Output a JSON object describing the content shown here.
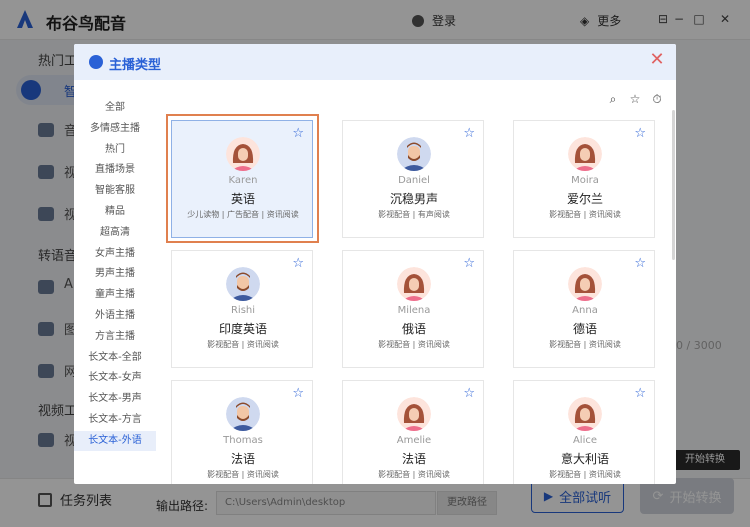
{
  "app": {
    "title": "布谷鸟配音",
    "login_label": "登录",
    "more_label": "更多",
    "minimize_glyph": "⊟",
    "restore_glyph": "−",
    "maximize_glyph": "□",
    "close_glyph": "✕"
  },
  "sidebar": {
    "items": [
      {
        "label": "热门工"
      },
      {
        "label": "智"
      },
      {
        "label": "音"
      },
      {
        "label": "视"
      },
      {
        "label": "视"
      },
      {
        "label": "转语音"
      },
      {
        "label": "A"
      },
      {
        "label": "图"
      },
      {
        "label": "网"
      },
      {
        "label": "视频工"
      },
      {
        "label": "视"
      }
    ]
  },
  "background": {
    "counter": "0 / 3000",
    "task_list_label": "任务列表",
    "output_path_label": "输出路径:",
    "output_path_value": "C:\\Users\\Admin\\desktop",
    "change_path_label": "更改路径",
    "trial_all_label": "全部试听",
    "start_convert_label": "开始转换",
    "tooltip": "开始转换"
  },
  "modal": {
    "title": "主播类型",
    "close_glyph": "✕",
    "categories": [
      {
        "label": "全部"
      },
      {
        "label": "多情感主播"
      },
      {
        "label": "热门"
      },
      {
        "label": "直播场景"
      },
      {
        "label": "智能客服"
      },
      {
        "label": "精品"
      },
      {
        "label": "超高清"
      },
      {
        "label": "女声主播"
      },
      {
        "label": "男声主播"
      },
      {
        "label": "童声主播"
      },
      {
        "label": "外语主播"
      },
      {
        "label": "方言主播"
      },
      {
        "label": "长文本-全部"
      },
      {
        "label": "长文本-女声"
      },
      {
        "label": "长文本-男声"
      },
      {
        "label": "长文本-方言"
      },
      {
        "label": "长文本-外语",
        "active": true
      }
    ],
    "tools": {
      "search": "⌕",
      "favorite": "☆",
      "history": "⏱"
    },
    "voices": [
      {
        "en": "Karen",
        "zh": "英语",
        "tags": "少儿读物 | 广告配音 | 资讯阅读",
        "gender": "female",
        "selected": true
      },
      {
        "en": "Daniel",
        "zh": "沉稳男声",
        "tags": "影视配音 | 有声阅读",
        "gender": "male"
      },
      {
        "en": "Moira",
        "zh": "爱尔兰",
        "tags": "影视配音 | 资讯阅读",
        "gender": "female"
      },
      {
        "en": "Rishi",
        "zh": "印度英语",
        "tags": "影视配音 | 资讯阅读",
        "gender": "male"
      },
      {
        "en": "Milena",
        "zh": "俄语",
        "tags": "影视配音 | 资讯阅读",
        "gender": "female"
      },
      {
        "en": "Anna",
        "zh": "德语",
        "tags": "影视配音 | 资讯阅读",
        "gender": "female"
      },
      {
        "en": "Thomas",
        "zh": "法语",
        "tags": "影视配音 | 资讯阅读",
        "gender": "male"
      },
      {
        "en": "Amelie",
        "zh": "法语",
        "tags": "影视配音 | 资讯阅读",
        "gender": "female"
      },
      {
        "en": "Alice",
        "zh": "意大利语",
        "tags": "影视配音 | 资讯阅读",
        "gender": "female"
      }
    ]
  },
  "colors": {
    "accent": "#2a61d6",
    "selection_frame": "#e0804f",
    "close_red": "#e06161"
  }
}
